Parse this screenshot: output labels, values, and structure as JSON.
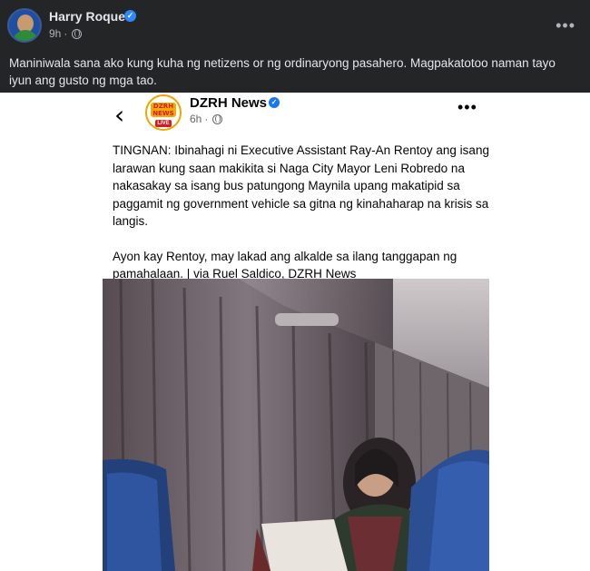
{
  "post": {
    "author": "Harry Roque",
    "time": "9h",
    "dot": "·",
    "caption": "Maniniwala sana ako kung kuha ng netizens or ng ordinaryong pasahero. Magpakatotoo naman tayo iyun ang gusto ng mga tao."
  },
  "shared": {
    "page_name": "DZRH News",
    "time": "6h",
    "dot": "·",
    "logo_text": "DZRH NEWS",
    "logo_live": "LIVE",
    "paragraph1": "TINGNAN: Ibinahagi ni Executive Assistant Ray-An Rentoy ang isang larawan kung saan makikita si Naga City Mayor Leni Robredo na nakasakay sa isang bus patungong Maynila upang makatipid sa paggamit ng government vehicle sa gitna ng kinahaharap na krisis sa langis.",
    "paragraph2": "Ayon kay Rentoy, may lakad ang alkalde sa ilang tanggapan ng pamahalaan. | via Ruel Saldico, DZRH News"
  },
  "icons": {
    "verified": "verified-badge-icon",
    "globe": "globe-icon",
    "more": "more-icon",
    "back": "back-chevron-icon"
  },
  "colors": {
    "background": "#242526",
    "verified": "#2d88ff",
    "card_background": "#ffffff"
  }
}
